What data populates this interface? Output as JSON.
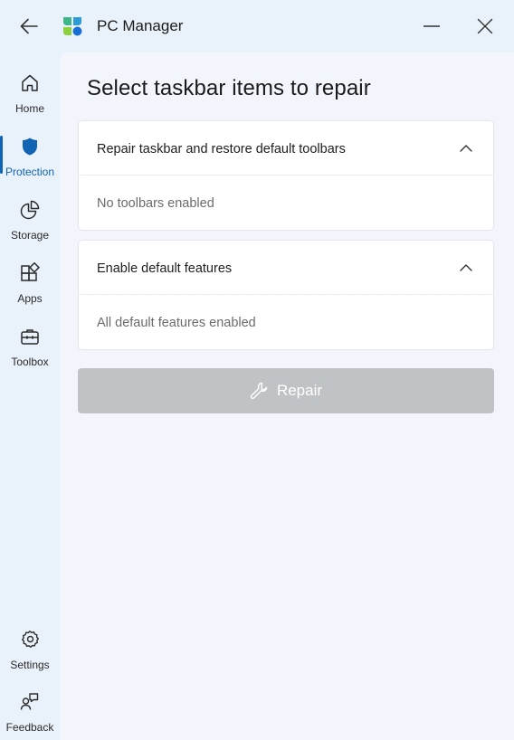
{
  "app": {
    "title": "PC Manager"
  },
  "sidebar": {
    "items": [
      {
        "label": "Home",
        "icon": "home-icon"
      },
      {
        "label": "Protection",
        "icon": "shield-icon",
        "active": true
      },
      {
        "label": "Storage",
        "icon": "pie-chart-icon"
      },
      {
        "label": "Apps",
        "icon": "apps-icon"
      },
      {
        "label": "Toolbox",
        "icon": "toolbox-icon"
      }
    ],
    "bottom": [
      {
        "label": "Settings",
        "icon": "gear-icon"
      },
      {
        "label": "Feedback",
        "icon": "feedback-icon"
      }
    ]
  },
  "main": {
    "title": "Select taskbar items to repair",
    "sections": [
      {
        "title": "Repair taskbar and restore default toolbars",
        "status": "No toolbars enabled",
        "expanded": true
      },
      {
        "title": "Enable default features",
        "status": "All default features enabled",
        "expanded": true
      }
    ],
    "repair_button": {
      "label": "Repair",
      "enabled": false
    }
  },
  "colors": {
    "accent": "#1164b4",
    "background": "#e9f1fa",
    "content_background": "#f2f6fc",
    "disabled_button": "#bfc3c6"
  }
}
